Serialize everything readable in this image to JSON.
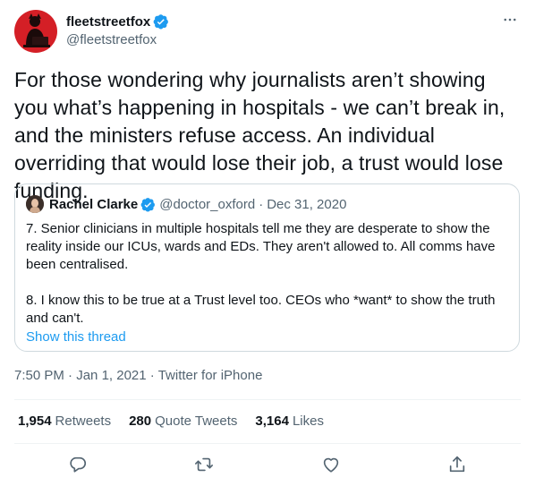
{
  "author": {
    "display_name": "fleetstreetfox",
    "handle": "@fleetstreetfox",
    "verified": true
  },
  "tweet": {
    "text": "For those wondering why journalists aren’t showing you what’s happening in hospitals - we can’t break in, and the ministers refuse access. An individual overriding that would lose their job, a trust would lose funding.",
    "time": "7:50 PM",
    "separator": "·",
    "date": "Jan 1, 2021",
    "source": "Twitter for iPhone"
  },
  "quoted": {
    "display_name": "Rachel Clarke",
    "handle": "@doctor_oxford",
    "dot": "·",
    "date": "Dec 31, 2020",
    "paragraph_1": "7. Senior clinicians in multiple hospitals tell me they are desperate to show the reality inside our ICUs, wards and EDs. They aren't allowed to. All comms have been centralised.",
    "paragraph_2": "8. I know this to be true at a Trust level too. CEOs who *want* to show the truth and can't.",
    "show_thread": "Show this thread"
  },
  "stats": {
    "retweets_count": "1,954",
    "retweets_label": "Retweets",
    "quotes_count": "280",
    "quotes_label": "Quote Tweets",
    "likes_count": "3,164",
    "likes_label": "Likes"
  },
  "icons": {
    "more": "more-horizontal-icon",
    "verified": "verified-badge-icon",
    "reply": "reply-icon",
    "retweet": "retweet-icon",
    "like": "heart-icon",
    "share": "share-icon"
  },
  "colors": {
    "accent": "#1d9bf0",
    "avatar_bg": "#d41f26",
    "text": "#0f1419",
    "muted": "#536471",
    "border": "#cfd9de"
  }
}
